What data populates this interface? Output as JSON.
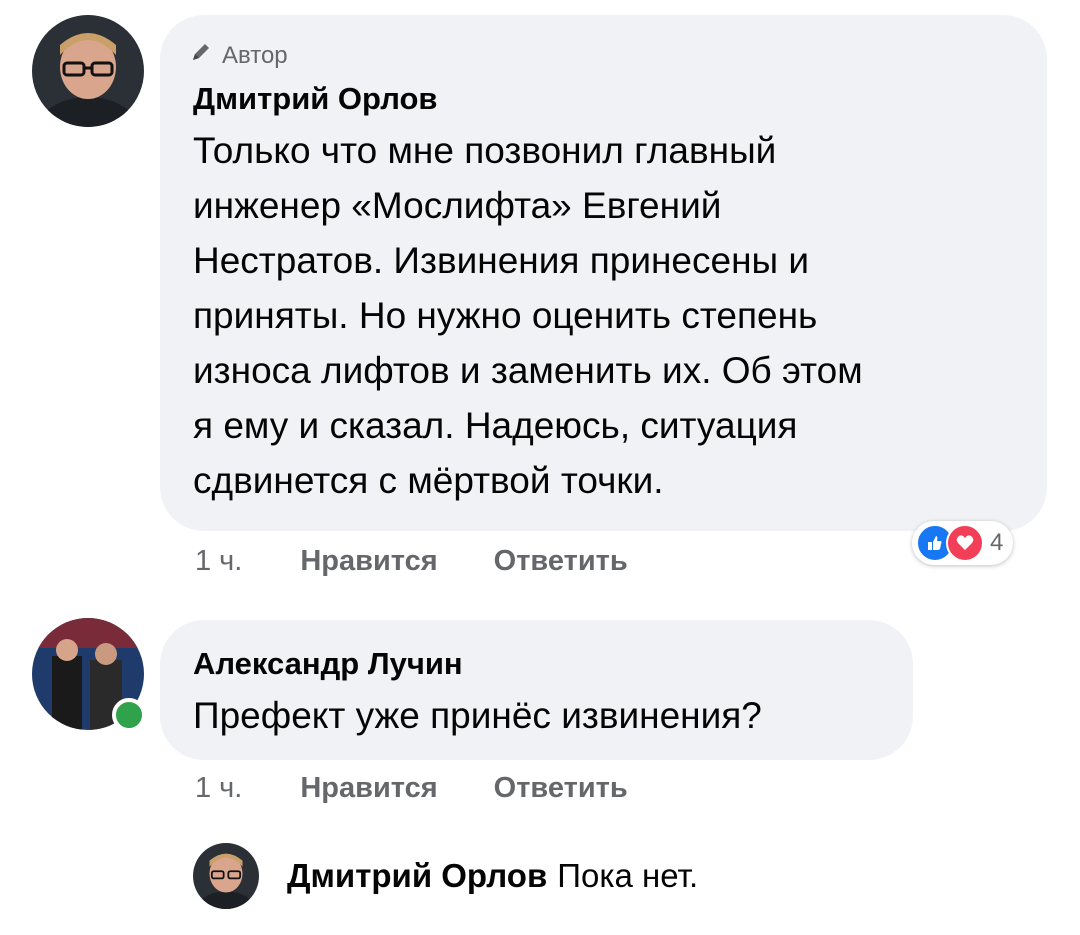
{
  "comments": [
    {
      "author_badge": "Автор",
      "name": "Дмитрий Орлов",
      "text": "Только что мне позвонил главный\nинженер «Мослифта» Евгений\nНестратов. Извинения принесены и\nприняты. Но нужно оценить степень\nизноса лифтов и заменить их. Об этом\nя ему и сказал. Надеюсь, ситуация\nсдвинется с мёртвой точки.",
      "time": "1 ч.",
      "like_label": "Нравится",
      "reply_label": "Ответить",
      "reaction_count": "4"
    },
    {
      "name": "Александр Лучин",
      "text": "Префект уже принёс извинения?",
      "time": "1 ч.",
      "like_label": "Нравится",
      "reply_label": "Ответить"
    }
  ],
  "reply": {
    "name": "Дмитрий Орлов",
    "text": "Пока нет."
  },
  "icons": {
    "author": "pencil-icon",
    "like": "like-reaction-icon",
    "love": "love-reaction-icon"
  },
  "colors": {
    "bubble": "#f0f2f5",
    "secondary_text": "#65676b",
    "like_blue": "#1877f2",
    "love_red": "#f33e58",
    "online_green": "#31a24c"
  }
}
